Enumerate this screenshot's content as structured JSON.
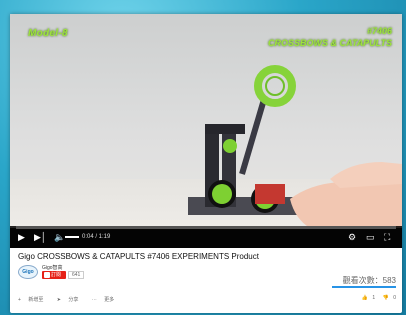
{
  "video": {
    "model_label": "Model-8",
    "code_label": "#7406",
    "title_label": "CROSSBOWS & CATAPULTS",
    "time": "0:04 / 1:19",
    "progress": 0.0
  },
  "info": {
    "title": "Gigo CROSSBOWS & CATAPULTS #7406 EXPERIMENTS Product",
    "channel_name": "Gigo智高",
    "channel_logo_text": "Gigo",
    "subscribe_label": "訂閱",
    "subscriber_count": "641",
    "views_label": "觀看次數：583",
    "add_label": "新增至",
    "share_label": "分享",
    "more_label": "更多",
    "likes_count": "1",
    "dislikes_count": "0"
  },
  "colors": {
    "accent_green": "#9ce33c",
    "subscribe_red": "#e62117",
    "progress_red": "#e52d27",
    "views_blue": "#2793e6"
  }
}
